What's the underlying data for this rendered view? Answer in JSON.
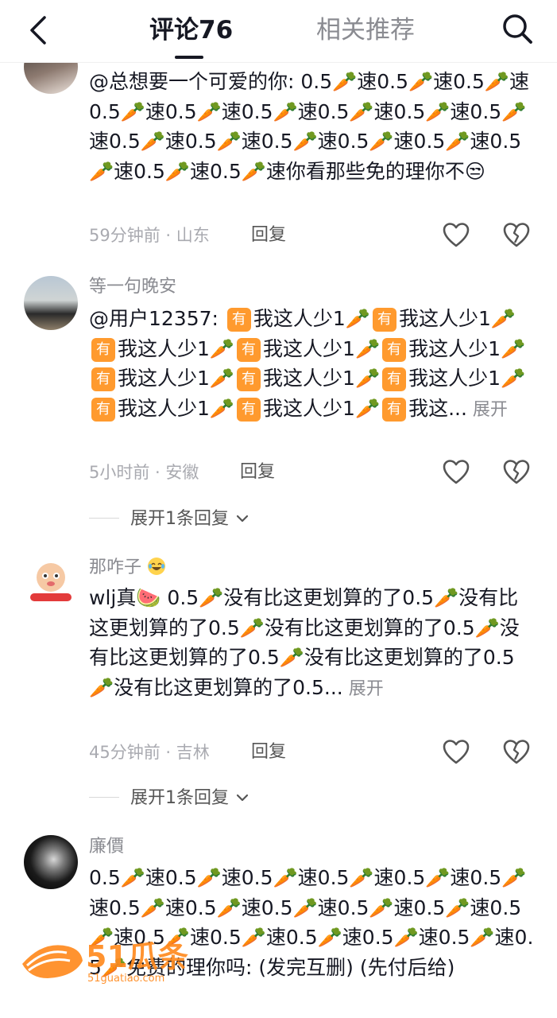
{
  "header": {
    "tab_comments": "评论76",
    "tab_related": "相关推荐"
  },
  "comments": [
    {
      "username": "",
      "text": "@总想要一个可爱的你: 0.5🥕速0.5🥕速0.5🥕速0.5🥕速0.5🥕速0.5🥕速0.5🥕速0.5🥕速0.5🥕速0.5🥕速0.5🥕速0.5🥕速0.5🥕速0.5🥕速0.5🥕速0.5🥕速0.5🥕速你看那些免的理你不😒",
      "time": "59分钟前 · 山东",
      "reply": "回复"
    },
    {
      "username": "等一句晚安",
      "text_prefix": "@用户12357: ",
      "repeat_text": "我这人少1",
      "tail": "我这...",
      "expand": "展开",
      "time": "5小时前 · 安徽",
      "reply": "回复",
      "expand_replies": "展开1条回复"
    },
    {
      "username": "那咋子",
      "text": "wlj真🍉 0.5🥕没有比这更划算的了0.5🥕没有比这更划算的了0.5🥕没有比这更划算的了0.5🥕没有比这更划算的了0.5🥕没有比这更划算的了0.5🥕没有比这更划算的了0.5...",
      "expand": "展开",
      "time": "45分钟前 · 吉林",
      "reply": "回复",
      "expand_replies": "展开1条回复"
    },
    {
      "username": "廉價",
      "text": "0.5🥕速0.5🥕速0.5🥕速0.5🥕速0.5🥕速0.5🥕速0.5🥕速0.5🥕速0.5🥕速0.5🥕速0.5🥕速0.5🥕速0.5🥕速0.5🥕速0.5🥕速0.5🥕速0.5🥕速0.5🥕免费的理你吗: (发完互删) (先付后给)"
    }
  ],
  "badge_char": "有",
  "watermark": {
    "brand": "51瓜条",
    "url": "51guatiao.com"
  },
  "colors": {
    "accent_orange": "#ff9a2e",
    "text_primary": "#161823",
    "text_secondary": "#8a8b91"
  }
}
